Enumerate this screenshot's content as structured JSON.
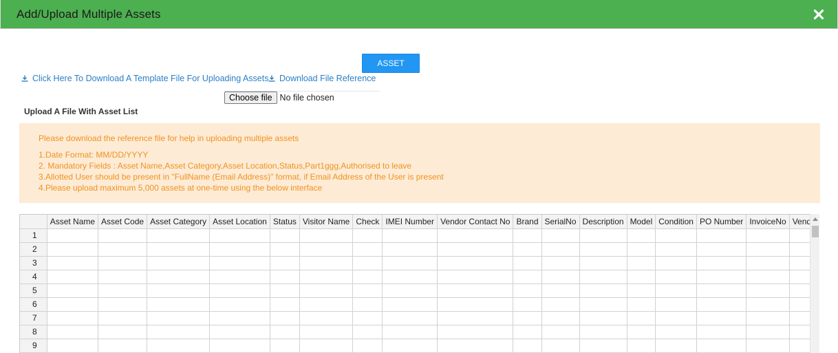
{
  "modal": {
    "title": "Add/Upload Multiple Assets",
    "close_icon": "close-icon",
    "header_color": "#4caf50"
  },
  "asset_button": {
    "label": "ASSET",
    "color": "#2196f3"
  },
  "links": {
    "template": "Click Here To Download A Template File For Uploading Assets",
    "reference": "Download File Reference",
    "icon": "download-icon"
  },
  "file_input": {
    "button_label": "Choose file",
    "status": "No file chosen"
  },
  "upload_label": "Upload A File With Asset List",
  "notice": {
    "intro": "Please download the reference file for help in uploading multiple assets",
    "lines": [
      "1.Date Format: MM/DD/YYYY",
      "2. Mandatory Fields : Asset Name,Asset Category,Asset Location,Status,Part1ggg,Authorised to leave",
      "3.Allotted User should be present in \"FullName (Email Address)\" format, if Email Address of the User is present",
      "4.Please upload maximum 5,000 assets at one-time using the below interface"
    ]
  },
  "grid": {
    "columns": [
      "Asset Name",
      "Asset Code",
      "Asset Category",
      "Asset Location",
      "Status",
      "Visitor Name",
      "Check",
      "IMEI Number",
      "Vendor Contact No",
      "Brand",
      "SerialNo",
      "Description",
      "Model",
      "Condition",
      "PO Number",
      "InvoiceNo",
      "Vendor"
    ],
    "rows": [
      "1",
      "2",
      "3",
      "4",
      "5",
      "6",
      "7",
      "8",
      "9"
    ]
  }
}
